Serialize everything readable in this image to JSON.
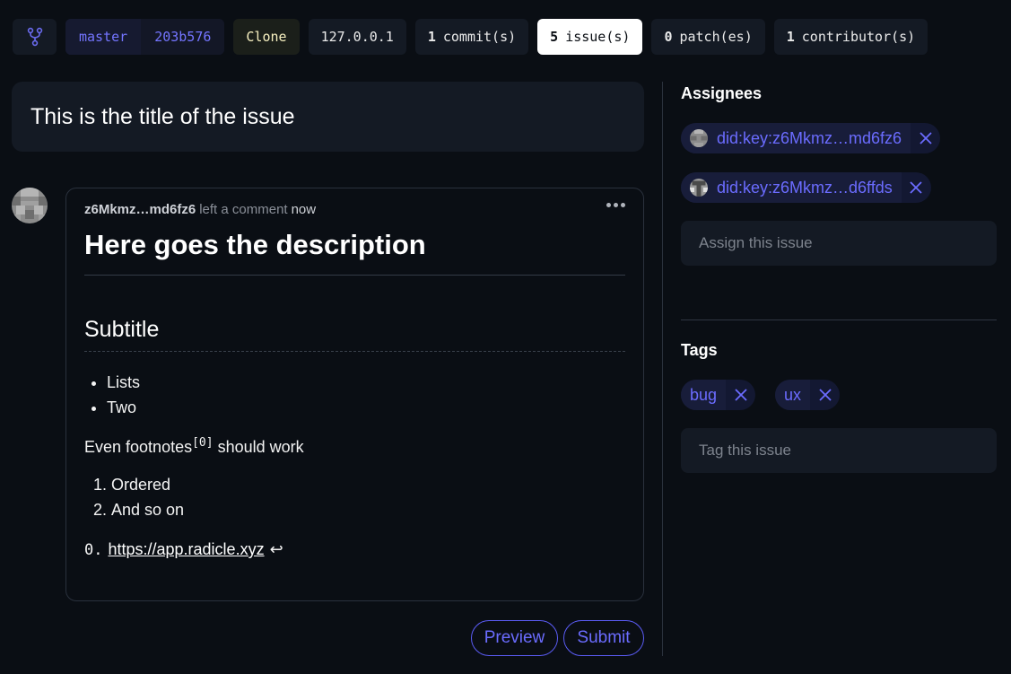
{
  "toolbar": {
    "branch": "master",
    "commit_hash": "203b576",
    "clone_label": "Clone",
    "host": "127.0.0.1",
    "commits": {
      "count": "1",
      "label": "commit(s)"
    },
    "issues": {
      "count": "5",
      "label": "issue(s)"
    },
    "patches": {
      "count": "0",
      "label": "patch(es)"
    },
    "contributors": {
      "count": "1",
      "label": "contributor(s)"
    }
  },
  "issue": {
    "title": "This is the title of the issue"
  },
  "comment": {
    "author": "z6Mkmz…md6fz6",
    "action": "left a comment",
    "time": "now",
    "h1": "Here goes the description",
    "h2": "Subtitle",
    "list": [
      "Lists",
      "Two"
    ],
    "para_before": "Even footnotes",
    "footnote_ref": "[0]",
    "para_after": " should work",
    "ordered": [
      "Ordered",
      "And so on"
    ],
    "footnote_num": "0.",
    "footnote_link": "https://app.radicle.xyz",
    "footnote_back": "↩"
  },
  "actions": {
    "preview": "Preview",
    "submit": "Submit"
  },
  "sidebar": {
    "assignees_title": "Assignees",
    "assignees": [
      "did:key:z6Mkmz…md6fz6",
      "did:key:z6Mkmz…d6ffds"
    ],
    "assign_placeholder": "Assign this issue",
    "tags_title": "Tags",
    "tags": [
      "bug",
      "ux"
    ],
    "tag_placeholder": "Tag this issue"
  },
  "colors": {
    "background": "#0a0e14",
    "accent": "#6b6cff",
    "surface": "#141a24"
  }
}
